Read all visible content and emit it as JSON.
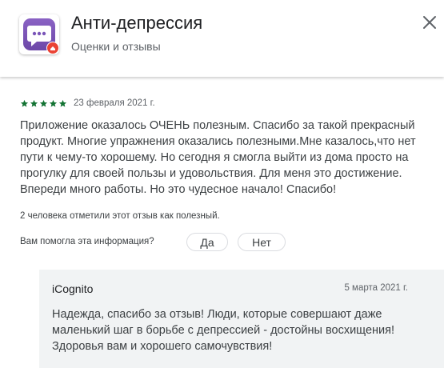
{
  "header": {
    "app_title": "Анти-депрессия",
    "subtitle": "Оценки и отзывы",
    "app_icon": "chat-bubble-icon",
    "close_icon": "close-icon"
  },
  "review": {
    "rating": 5,
    "rating_max": 5,
    "star_color": "#137333",
    "date": "23 февраля 2021 г.",
    "text": "Приложение оказалось ОЧЕНЬ полезным. Спасибо за такой прекрасный продукт. Многие упражнения оказались полезными.Мне казалось,что нет пути к чему-то хорошему. Но сегодня я смогла выйти из дома просто на прогулку для своей пользы и удовольствия. Для меня это достижение. Впереди много работы. Но это чудесное начало! Спасибо!",
    "helpful_count_text": "2 человека отметили этот отзыв как полезный.",
    "helpful_question": "Вам помогла эта информация?",
    "yes_label": "Да",
    "no_label": "Нет"
  },
  "reply": {
    "author": "iCognito",
    "date": "5 марта 2021 г.",
    "text": "Надежда, спасибо за отзыв! Люди, которые совершают даже маленький шаг в борьбе с депрессией - достойны восхищения! Здоровья вам и хорошего самочувствия!"
  }
}
